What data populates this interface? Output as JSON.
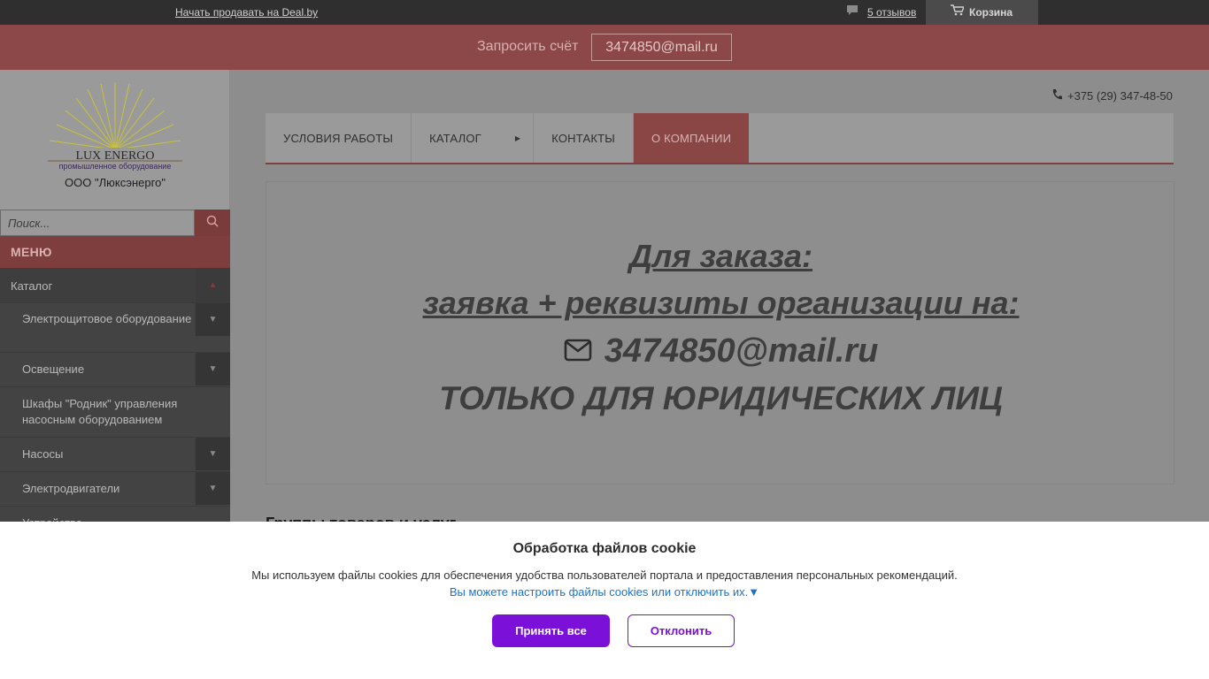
{
  "topbar": {
    "sell_link": "Начать продавать на Deal.by",
    "reviews": "5 отзывов",
    "cart": "Корзина",
    "icons": [
      "comment-icon",
      "cart-icon"
    ]
  },
  "redbar": {
    "request_label": "Запросить счёт",
    "email": "3474850@mail.ru"
  },
  "company": {
    "logo_title": "LUX ENERGO",
    "logo_subtitle": "промышленное оборудование",
    "name": "ООО \"Люксэнерго\""
  },
  "search": {
    "placeholder": "Поиск..."
  },
  "menu": {
    "heading": "МЕНЮ",
    "items": [
      {
        "label": "Каталог",
        "level": 0,
        "has_arrow": true
      },
      {
        "label": "Электрощитовое оборудование",
        "level": 1,
        "has_arrow": true
      },
      {
        "label": "Освещение",
        "level": 1,
        "has_arrow": true
      },
      {
        "label": "Шкафы \"Родник\" управления насосным оборудованием",
        "level": 1,
        "has_arrow": false
      },
      {
        "label": "Насосы",
        "level": 1,
        "has_arrow": true
      },
      {
        "label": "Электродвигатели",
        "level": 1,
        "has_arrow": true
      },
      {
        "label": "Устройства",
        "level": 1,
        "has_arrow": false
      }
    ]
  },
  "header": {
    "phone": "+375 (29) 347-48-50"
  },
  "nav": {
    "items": [
      {
        "label": "УСЛОВИЯ РАБОТЫ",
        "active": false
      },
      {
        "label": "КАТАЛОГ",
        "active": false
      },
      {
        "label": "КОНТАКТЫ",
        "active": false
      },
      {
        "label": "О КОМПАНИИ",
        "active": true
      }
    ]
  },
  "banner": {
    "line1": "Для заказа:",
    "line2": "заявка + реквизиты организации на:",
    "line3": "3474850@mail.ru",
    "line4": "ТОЛЬКО ДЛЯ ЮРИДИЧЕСКИХ ЛИЦ"
  },
  "main": {
    "groups_title": "Группы товаров и услуг"
  },
  "cookie": {
    "title": "Обработка файлов cookie",
    "description": "Мы используем файлы cookies для обеспечения удобства пользователей портала и предоставления персональных рекомендаций.",
    "settings_link": "Вы можете настроить файлы cookies или отключить их.▼",
    "accept": "Принять все",
    "decline": "Отклонить",
    "accent_color": "#7b10d8"
  }
}
